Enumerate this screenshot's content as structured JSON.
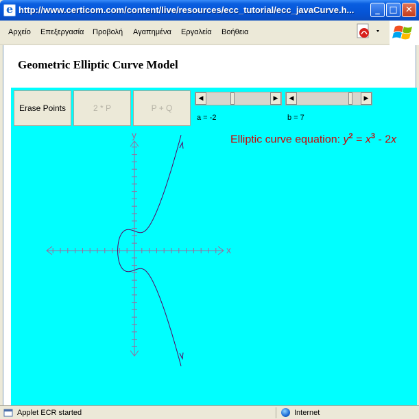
{
  "window": {
    "title": "http://www.certicom.com/content/live/resources/ecc_tutorial/ecc_javaCurve.h...",
    "minimize": "_",
    "maximize": "□",
    "close": "✕"
  },
  "menu": {
    "items": [
      "Αρχείο",
      "Επεξεργασία",
      "Προβολή",
      "Αγαπημένα",
      "Εργαλεία",
      "Βοήθεια"
    ]
  },
  "page": {
    "heading": "Geometric Elliptic Curve Model"
  },
  "applet": {
    "buttons": {
      "erase": "Erase Points",
      "double": "2 * P",
      "add": "P + Q"
    },
    "slider_a": {
      "label": "a = -2",
      "value": -2
    },
    "slider_b": {
      "label": "b = 7",
      "value": 7
    },
    "equation": {
      "prefix": "Elliptic curve equation: ",
      "y": "y",
      "y_exp": "2",
      "eq": " = ",
      "x": "x",
      "x_exp": "3",
      "rest_minus": " - 2",
      "rest_x": "x"
    },
    "axes": {
      "x_label": "x",
      "y_label": "y"
    },
    "colors": {
      "background": "#00ffff",
      "axis": "#8b5a8b",
      "curve": "#5b0060",
      "equation": "#d10000"
    }
  },
  "status": {
    "text": "Applet ECR started",
    "zone": "Internet"
  }
}
